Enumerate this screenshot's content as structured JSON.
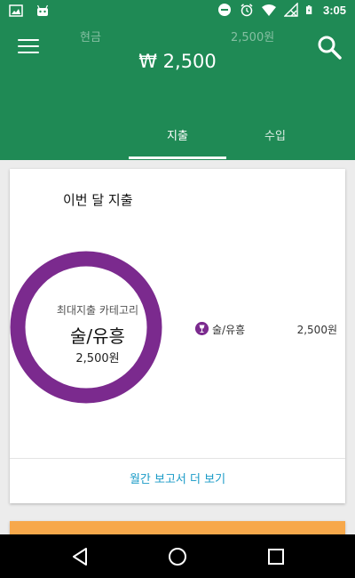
{
  "status_bar": {
    "time": "3:05",
    "icons": [
      "image-icon",
      "android-icon",
      "dnd-icon",
      "alarm-icon",
      "wifi-icon",
      "signal-icon",
      "battery-icon"
    ]
  },
  "app_bar": {
    "account_label": "현금",
    "account_amount": "2,500원",
    "balance": "₩ 2,500",
    "tabs": [
      {
        "label": "지출",
        "selected": true
      },
      {
        "label": "수입",
        "selected": false
      }
    ],
    "colors": {
      "primary": "#1f8a55"
    }
  },
  "card": {
    "title": "이번 달 지출",
    "top_category_caption": "최대지출 카테고리",
    "top_category_name": "술/유흥",
    "top_category_amount": "2,500원",
    "legend": [
      {
        "icon": "wine-glass-icon",
        "label": "술/유흥",
        "value": "2,500원",
        "color": "#7b2a8e"
      }
    ],
    "more_link": "월간 보고서 더 보기"
  },
  "chart_data": {
    "type": "pie",
    "categories": [
      "술/유흥"
    ],
    "values": [
      2500
    ],
    "colors": [
      "#7b2a8e"
    ],
    "title": ""
  },
  "nav_bar": {
    "buttons": [
      "back-icon",
      "home-icon",
      "recents-icon"
    ]
  }
}
